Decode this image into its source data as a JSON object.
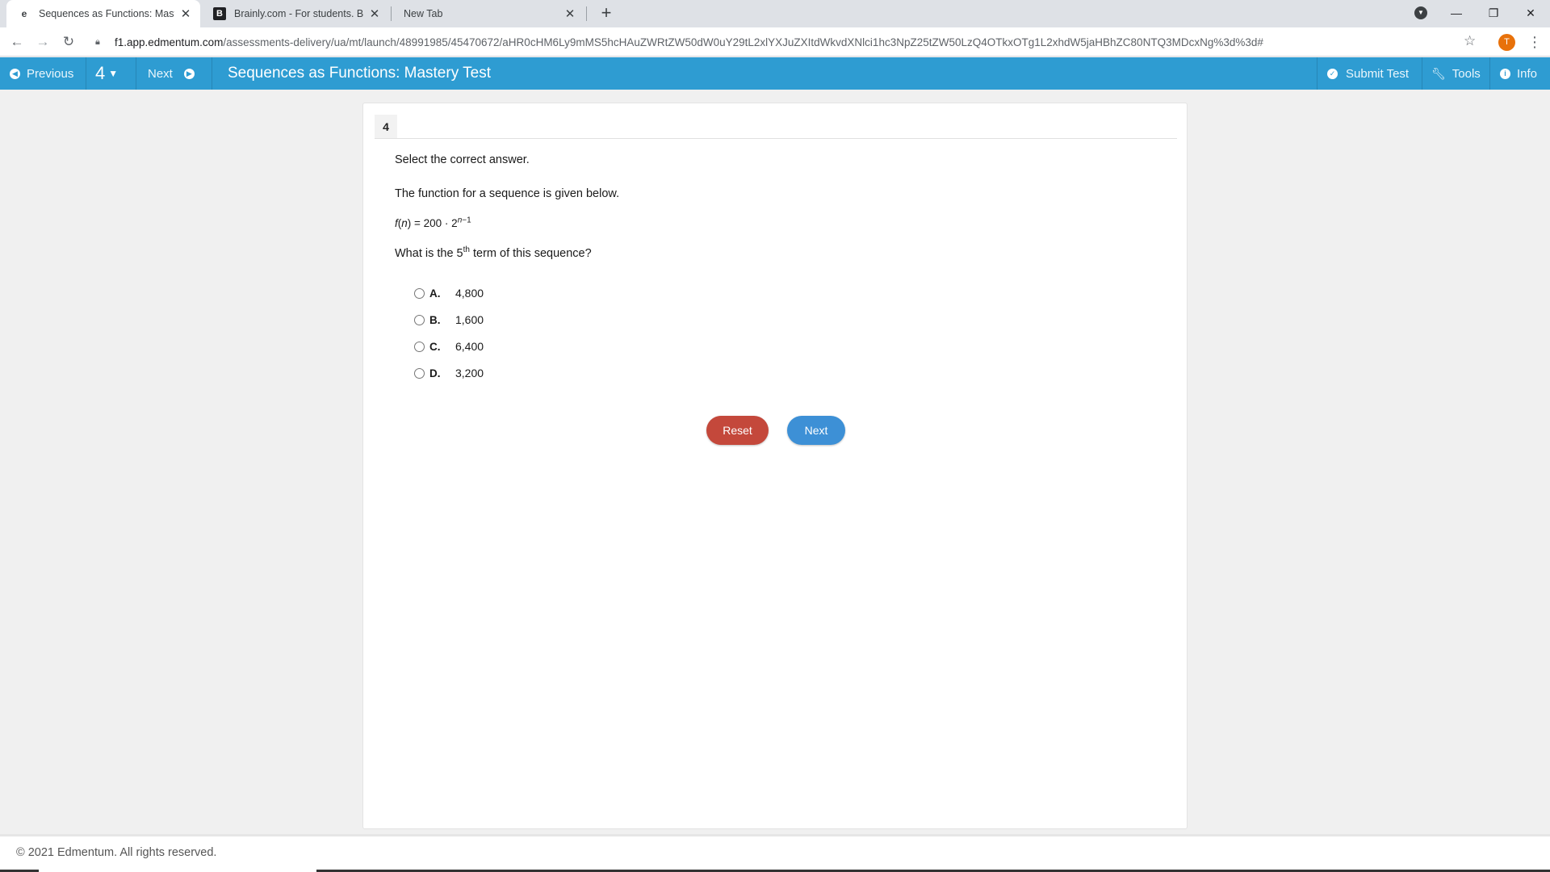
{
  "browser": {
    "tabs": [
      {
        "label": "Sequences as Functions: Mastery",
        "favicon": "edmentum-icon",
        "active": true
      },
      {
        "label": "Brainly.com - For students. By stu",
        "favicon": "brainly-icon",
        "active": false
      },
      {
        "label": "New Tab",
        "favicon": "",
        "active": false
      }
    ],
    "url_host": "f1.app.edmentum.com",
    "url_path": "/assessments-delivery/ua/mt/launch/48991985/45470672/aHR0cHM6Ly9mMS5hcHAuZWRtZW50dW0uY29tL2xlYXJuZXItdWkvdXNlci1hc3NpZ25tZW50LzQ4OTkxOTg1L2xhdW5jaHBhZC80NTQ3MDcxNg%3d%3d#",
    "profile_initial": "T",
    "colors": {
      "profile": "#e8710a"
    }
  },
  "app": {
    "previous_label": "Previous",
    "question_number": "4",
    "next_label": "Next",
    "title": "Sequences as Functions: Mastery Test",
    "submit_label": "Submit Test",
    "tools_label": "Tools",
    "info_label": "Info",
    "colors": {
      "header": "#2e9cd2",
      "reset": "#c4483b",
      "next": "#3d90d6"
    }
  },
  "question": {
    "number": "4",
    "instruction": "Select the correct answer.",
    "intro": "The function for a sequence is given below.",
    "formula": {
      "fn": "f",
      "var": "n",
      "body": ") = 200 · 2",
      "exp_var": "n",
      "exp_rest": "−1"
    },
    "ask_before": "What is the 5",
    "ask_sup": "th",
    "ask_after": " term of this sequence?",
    "options": [
      {
        "letter": "A.",
        "value": "4,800"
      },
      {
        "letter": "B.",
        "value": "1,600"
      },
      {
        "letter": "C.",
        "value": "6,400"
      },
      {
        "letter": "D.",
        "value": "3,200"
      }
    ],
    "reset_label": "Reset",
    "next_label": "Next"
  },
  "footer": {
    "copyright": "© 2021 Edmentum. All rights reserved."
  }
}
